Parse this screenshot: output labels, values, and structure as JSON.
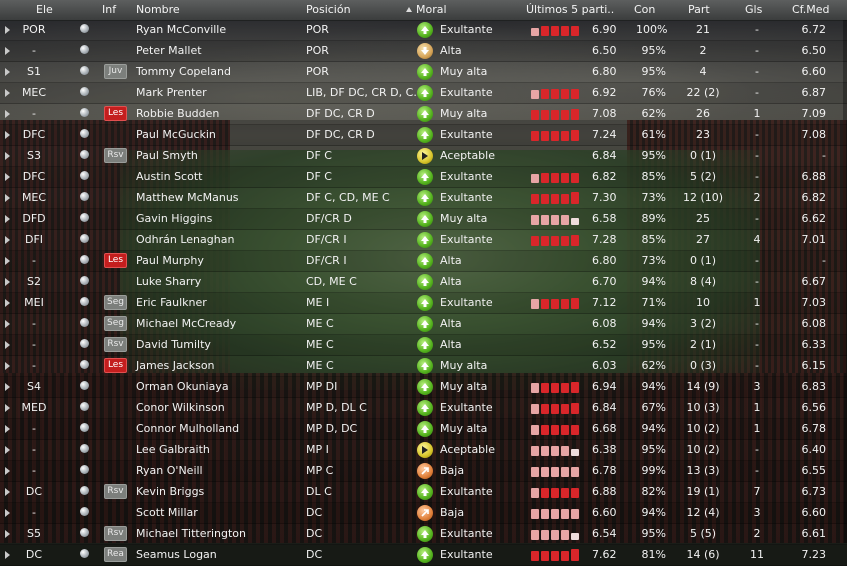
{
  "headers": {
    "pos": "Ele",
    "info": "Inf",
    "name": "Nombre",
    "position": "Posición",
    "moral": "Moral",
    "form": "Últimos 5 parti..",
    "con": "Con",
    "apps": "Part",
    "goals": "Gls",
    "avg": "Cf.Med"
  },
  "sort": {
    "column": "moral",
    "direction": "ascending"
  },
  "colors": {
    "form_red": "#d9262a",
    "form_pink": "#e7a5a5",
    "form_light": "#efdcdc",
    "form_white": "#f4f4f4",
    "badge_red": "#c41e1e",
    "badge_gray": "#7c7f7c"
  },
  "rows": [
    {
      "pos": "POR",
      "badge": "",
      "badge_color": "",
      "name": "Ryan McConville",
      "position": "POR",
      "moral_icon": "up-arrow-green",
      "moral": "Exultante",
      "form": [
        [
          "pink",
          0.7
        ],
        [
          "red",
          0.85
        ],
        [
          "red",
          0.85
        ],
        [
          "red",
          0.85
        ],
        [
          "red",
          0.85
        ]
      ],
      "rating": "6.90",
      "con": "100%",
      "apps": "21",
      "goals": "-",
      "avg": "6.72"
    },
    {
      "pos": "-",
      "badge": "",
      "badge_color": "",
      "name": "Peter Mallet",
      "position": "POR",
      "moral_icon": "down-arrow-tan",
      "moral": "Alta",
      "form": [],
      "rating": "6.50",
      "con": "95%",
      "apps": "2",
      "goals": "-",
      "avg": "6.50"
    },
    {
      "pos": "S1",
      "badge": "Juv",
      "badge_color": "gray",
      "name": "Tommy Copeland",
      "position": "POR",
      "moral_icon": "up-arrow-green",
      "moral": "Muy alta",
      "form": [],
      "rating": "6.80",
      "con": "95%",
      "apps": "4",
      "goals": "-",
      "avg": "6.60"
    },
    {
      "pos": "MEC",
      "badge": "",
      "badge_color": "",
      "name": "Mark Prenter",
      "position": "LIB, DF DC, CR D, C..",
      "moral_icon": "up-arrow-green",
      "moral": "Exultante",
      "form": [
        [
          "pink",
          0.75
        ],
        [
          "red",
          0.85
        ],
        [
          "red",
          0.85
        ],
        [
          "red",
          0.85
        ],
        [
          "red",
          0.85
        ]
      ],
      "rating": "6.92",
      "con": "76%",
      "apps": "22 (2)",
      "goals": "-",
      "avg": "6.87"
    },
    {
      "pos": "-",
      "badge": "Les",
      "badge_color": "red",
      "name": "Robbie Budden",
      "position": "DF DC, CR D",
      "moral_icon": "up-arrow-green",
      "moral": "Muy alta",
      "form": [
        [
          "red",
          0.85
        ],
        [
          "red",
          0.85
        ],
        [
          "red",
          0.85
        ],
        [
          "red",
          0.85
        ],
        [
          "red",
          0.9
        ]
      ],
      "rating": "7.08",
      "con": "62%",
      "apps": "26",
      "goals": "1",
      "avg": "7.09"
    },
    {
      "pos": "DFC",
      "badge": "",
      "badge_color": "",
      "name": "Paul McGuckin",
      "position": "DF DC, CR D",
      "moral_icon": "up-arrow-green",
      "moral": "Exultante",
      "form": [
        [
          "red",
          0.85
        ],
        [
          "red",
          0.85
        ],
        [
          "red",
          0.85
        ],
        [
          "red",
          0.85
        ],
        [
          "red",
          0.9
        ]
      ],
      "rating": "7.24",
      "con": "61%",
      "apps": "23",
      "goals": "-",
      "avg": "7.08"
    },
    {
      "pos": "S3",
      "badge": "Rsv",
      "badge_color": "gray",
      "name": "Paul Smyth",
      "position": "DF C",
      "moral_icon": "right-arrow-yellow",
      "moral": "Aceptable",
      "form": [],
      "rating": "6.84",
      "con": "95%",
      "apps": "0 (1)",
      "goals": "-",
      "avg": "-"
    },
    {
      "pos": "DFC",
      "badge": "",
      "badge_color": "",
      "name": "Austin Scott",
      "position": "DF C",
      "moral_icon": "up-arrow-green",
      "moral": "Exultante",
      "form": [
        [
          "pink",
          0.75
        ],
        [
          "red",
          0.85
        ],
        [
          "red",
          0.85
        ],
        [
          "red",
          0.85
        ],
        [
          "red",
          0.85
        ]
      ],
      "rating": "6.82",
      "con": "85%",
      "apps": "5 (2)",
      "goals": "-",
      "avg": "6.88"
    },
    {
      "pos": "MEC",
      "badge": "",
      "badge_color": "",
      "name": "Matthew McManus",
      "position": "DF C, CD, ME C",
      "moral_icon": "up-arrow-green",
      "moral": "Exultante",
      "form": [
        [
          "red",
          0.85
        ],
        [
          "red",
          0.85
        ],
        [
          "red",
          0.85
        ],
        [
          "red",
          0.85
        ],
        [
          "red",
          1.0
        ]
      ],
      "rating": "7.30",
      "con": "73%",
      "apps": "12 (10)",
      "goals": "2",
      "avg": "6.82"
    },
    {
      "pos": "DFD",
      "badge": "",
      "badge_color": "",
      "name": "Gavin Higgins",
      "position": "DF/CR D",
      "moral_icon": "up-arrow-green",
      "moral": "Muy alta",
      "form": [
        [
          "pink",
          0.8
        ],
        [
          "pink",
          0.8
        ],
        [
          "pink",
          0.8
        ],
        [
          "pink",
          0.8
        ],
        [
          "light",
          0.55
        ]
      ],
      "rating": "6.58",
      "con": "89%",
      "apps": "25",
      "goals": "-",
      "avg": "6.62"
    },
    {
      "pos": "DFI",
      "badge": "",
      "badge_color": "",
      "name": "Odhrán Lenaghan",
      "position": "DF/CR I",
      "moral_icon": "up-arrow-green",
      "moral": "Exultante",
      "form": [
        [
          "red",
          0.85
        ],
        [
          "red",
          0.85
        ],
        [
          "red",
          0.85
        ],
        [
          "red",
          0.85
        ],
        [
          "red",
          0.9
        ]
      ],
      "rating": "7.28",
      "con": "85%",
      "apps": "27",
      "goals": "4",
      "avg": "7.01"
    },
    {
      "pos": "-",
      "badge": "Les",
      "badge_color": "red",
      "name": "Paul Murphy",
      "position": "DF/CR I",
      "moral_icon": "up-arrow-green",
      "moral": "Alta",
      "form": [],
      "rating": "6.80",
      "con": "73%",
      "apps": "0 (1)",
      "goals": "-",
      "avg": "-"
    },
    {
      "pos": "S2",
      "badge": "",
      "badge_color": "",
      "name": "Luke Sharry",
      "position": "CD, ME C",
      "moral_icon": "up-arrow-green",
      "moral": "Alta",
      "form": [],
      "rating": "6.70",
      "con": "94%",
      "apps": "8 (4)",
      "goals": "-",
      "avg": "6.67"
    },
    {
      "pos": "MEI",
      "badge": "Seg",
      "badge_color": "gray",
      "name": "Eric Faulkner",
      "position": "ME I",
      "moral_icon": "up-arrow-green",
      "moral": "Exultante",
      "form": [
        [
          "pink",
          0.8
        ],
        [
          "red",
          0.85
        ],
        [
          "red",
          0.85
        ],
        [
          "red",
          0.85
        ],
        [
          "red",
          0.9
        ]
      ],
      "rating": "7.12",
      "con": "71%",
      "apps": "10",
      "goals": "1",
      "avg": "7.03"
    },
    {
      "pos": "-",
      "badge": "Seg",
      "badge_color": "gray",
      "name": "Michael McCready",
      "position": "ME C",
      "moral_icon": "up-arrow-green",
      "moral": "Alta",
      "form": [],
      "rating": "6.08",
      "con": "94%",
      "apps": "3 (2)",
      "goals": "-",
      "avg": "6.08"
    },
    {
      "pos": "-",
      "badge": "Rsv",
      "badge_color": "gray",
      "name": "David Tumilty",
      "position": "ME C",
      "moral_icon": "up-arrow-green",
      "moral": "Alta",
      "form": [],
      "rating": "6.52",
      "con": "95%",
      "apps": "2 (1)",
      "goals": "-",
      "avg": "6.33"
    },
    {
      "pos": "-",
      "badge": "Les",
      "badge_color": "red",
      "name": "James Jackson",
      "position": "ME C",
      "moral_icon": "up-arrow-green",
      "moral": "Muy alta",
      "form": [],
      "rating": "6.03",
      "con": "62%",
      "apps": "0 (3)",
      "goals": "-",
      "avg": "6.15"
    },
    {
      "pos": "S4",
      "badge": "",
      "badge_color": "",
      "name": "Orman Okuniaya",
      "position": "MP DI",
      "moral_icon": "up-arrow-green",
      "moral": "Muy alta",
      "form": [
        [
          "pink",
          0.8
        ],
        [
          "red",
          0.85
        ],
        [
          "red",
          0.85
        ],
        [
          "red",
          0.85
        ],
        [
          "red",
          0.9
        ]
      ],
      "rating": "6.94",
      "con": "94%",
      "apps": "14 (9)",
      "goals": "3",
      "avg": "6.83"
    },
    {
      "pos": "MED",
      "badge": "",
      "badge_color": "",
      "name": "Conor Wilkinson",
      "position": "MP D, DL C",
      "moral_icon": "up-arrow-green",
      "moral": "Exultante",
      "form": [
        [
          "pink",
          0.8
        ],
        [
          "red",
          0.85
        ],
        [
          "red",
          0.85
        ],
        [
          "red",
          0.85
        ],
        [
          "red",
          0.9
        ]
      ],
      "rating": "6.84",
      "con": "67%",
      "apps": "10 (3)",
      "goals": "1",
      "avg": "6.56"
    },
    {
      "pos": "-",
      "badge": "",
      "badge_color": "",
      "name": "Connor Mulholland",
      "position": "MP D, DC",
      "moral_icon": "up-arrow-green",
      "moral": "Muy alta",
      "form": [
        [
          "pink",
          0.8
        ],
        [
          "red",
          0.85
        ],
        [
          "red",
          0.85
        ],
        [
          "red",
          0.85
        ],
        [
          "red",
          0.85
        ]
      ],
      "rating": "6.68",
      "con": "94%",
      "apps": "10 (2)",
      "goals": "1",
      "avg": "6.78"
    },
    {
      "pos": "-",
      "badge": "",
      "badge_color": "",
      "name": "Lee Galbraith",
      "position": "MP I",
      "moral_icon": "right-arrow-yellow",
      "moral": "Aceptable",
      "form": [
        [
          "pink",
          0.8
        ],
        [
          "pink",
          0.8
        ],
        [
          "pink",
          0.8
        ],
        [
          "pink",
          0.8
        ],
        [
          "light",
          0.55
        ]
      ],
      "rating": "6.38",
      "con": "95%",
      "apps": "10 (2)",
      "goals": "-",
      "avg": "6.40"
    },
    {
      "pos": "-",
      "badge": "",
      "badge_color": "",
      "name": "Ryan O'Neill",
      "position": "MP C",
      "moral_icon": "down-arrow-orange",
      "moral": "Baja",
      "form": [
        [
          "pink",
          0.8
        ],
        [
          "pink",
          0.8
        ],
        [
          "pink",
          0.8
        ],
        [
          "pink",
          0.8
        ],
        [
          "pink",
          0.8
        ]
      ],
      "rating": "6.78",
      "con": "99%",
      "apps": "13 (3)",
      "goals": "-",
      "avg": "6.55"
    },
    {
      "pos": "DC",
      "badge": "Rsv",
      "badge_color": "gray",
      "name": "Kevin Briggs",
      "position": "DL C",
      "moral_icon": "up-arrow-green",
      "moral": "Exultante",
      "form": [
        [
          "pink",
          0.8
        ],
        [
          "red",
          0.85
        ],
        [
          "red",
          0.85
        ],
        [
          "red",
          0.85
        ],
        [
          "red",
          0.85
        ]
      ],
      "rating": "6.88",
      "con": "82%",
      "apps": "19 (1)",
      "goals": "7",
      "avg": "6.73"
    },
    {
      "pos": "-",
      "badge": "",
      "badge_color": "",
      "name": "Scott Millar",
      "position": "DC",
      "moral_icon": "down-arrow-orange",
      "moral": "Baja",
      "form": [
        [
          "pink",
          0.8
        ],
        [
          "pink",
          0.8
        ],
        [
          "pink",
          0.8
        ],
        [
          "pink",
          0.8
        ],
        [
          "pink",
          0.8
        ]
      ],
      "rating": "6.60",
      "con": "94%",
      "apps": "12 (4)",
      "goals": "3",
      "avg": "6.60"
    },
    {
      "pos": "S5",
      "badge": "Rsv",
      "badge_color": "gray",
      "name": "Michael Titterington",
      "position": "DC",
      "moral_icon": "up-arrow-green",
      "moral": "Exultante",
      "form": [
        [
          "pink",
          0.8
        ],
        [
          "pink",
          0.8
        ],
        [
          "pink",
          0.8
        ],
        [
          "pink",
          0.8
        ],
        [
          "light",
          0.55
        ]
      ],
      "rating": "6.54",
      "con": "95%",
      "apps": "5 (5)",
      "goals": "2",
      "avg": "6.61"
    },
    {
      "pos": "DC",
      "badge": "Rea",
      "badge_color": "gray",
      "name": "Seamus Logan",
      "position": "DC",
      "moral_icon": "up-arrow-green",
      "moral": "Exultante",
      "form": [
        [
          "red",
          0.85
        ],
        [
          "red",
          0.85
        ],
        [
          "red",
          0.85
        ],
        [
          "red",
          0.85
        ],
        [
          "red",
          1.0
        ]
      ],
      "rating": "7.62",
      "con": "81%",
      "apps": "14 (6)",
      "goals": "11",
      "avg": "7.23"
    }
  ]
}
